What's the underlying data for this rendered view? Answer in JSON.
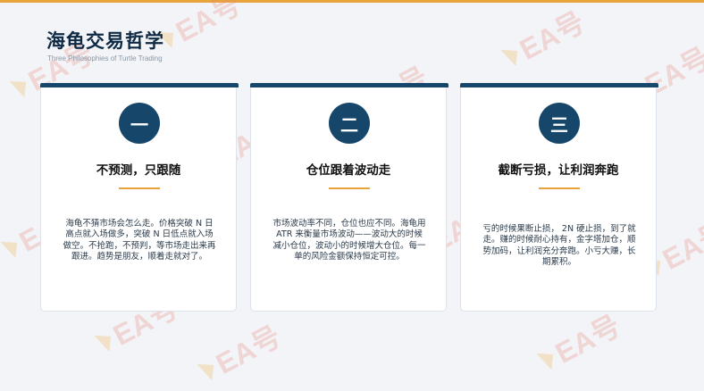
{
  "header": {
    "title": "海龟交易哲学",
    "subtitle": "Three Philosophies of Turtle Trading"
  },
  "cards": [
    {
      "number": "一",
      "heading": "不预测，只跟随",
      "body": "海龟不猜市场会怎么走。价格突破 N 日高点就入场做多，突破 N 日低点就入场做空。不抢跑，不预判，等市场走出来再跟进。趋势是朋友，顺着走就对了。"
    },
    {
      "number": "二",
      "heading": "仓位跟着波动走",
      "body": "市场波动率不同，仓位也应不同。海龟用 ATR 来衡量市场波动——波动大的时候减小仓位，波动小的时候增大仓位。每一单的风险金额保持恒定可控。"
    },
    {
      "number": "三",
      "heading": "截断亏损，让利润奔跑",
      "body": "亏的时候果断止损， 2N 硬止损，到了就走。赚的时候耐心持有，金字塔加仓，顺势加码，让利润充分奔跑。小亏大赚，长期累积。"
    }
  ],
  "watermark": {
    "text": "EA号"
  },
  "colors": {
    "navy": "#16476b",
    "accent": "#e8a33a",
    "background": "#f2f4f8"
  }
}
